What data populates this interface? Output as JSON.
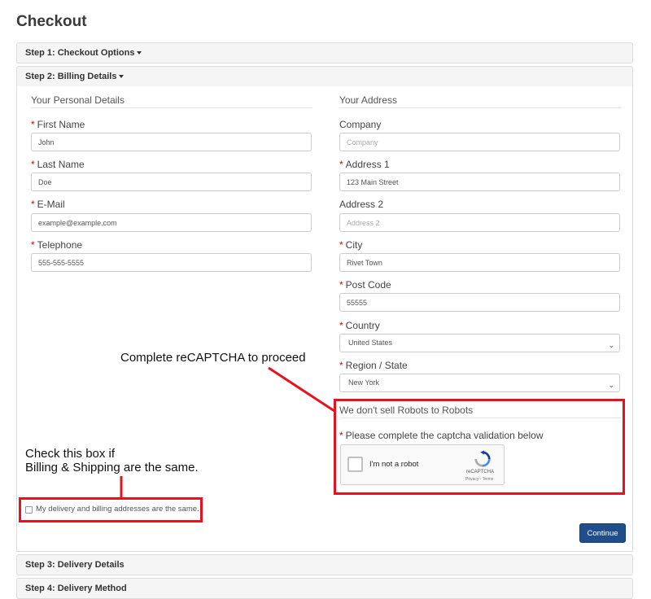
{
  "page": {
    "title": "Checkout"
  },
  "steps": {
    "step1": "Step 1: Checkout Options",
    "step2": "Step 2: Billing Details",
    "step3": "Step 3: Delivery Details",
    "step4": "Step 4: Delivery Method"
  },
  "personal": {
    "legend": "Your Personal Details",
    "first_name": {
      "label": "First Name",
      "value": "John"
    },
    "last_name": {
      "label": "Last Name",
      "value": "Doe"
    },
    "email": {
      "label": "E-Mail",
      "value": "example@example.com"
    },
    "telephone": {
      "label": "Telephone",
      "value": "555-555-5555"
    }
  },
  "address": {
    "legend": "Your Address",
    "company": {
      "label": "Company",
      "placeholder": "Company"
    },
    "address1": {
      "label": "Address 1",
      "value": "123 Main Street"
    },
    "address2": {
      "label": "Address 2",
      "placeholder": "Address 2"
    },
    "city": {
      "label": "City",
      "value": "Rivet Town"
    },
    "postcode": {
      "label": "Post Code",
      "value": "55555"
    },
    "country": {
      "label": "Country",
      "value": "United States"
    },
    "region": {
      "label": "Region / State",
      "value": "New York"
    }
  },
  "captcha": {
    "legend": "We don't sell Robots to Robots",
    "label": "Please complete the captcha validation below",
    "checkbox_text": "I'm not a robot",
    "brand": "reCAPTCHA",
    "terms": "Privacy - Terms"
  },
  "same_address": {
    "label": "My delivery and billing addresses are the same."
  },
  "continue_label": "Continue",
  "annotations": {
    "captcha_note": "Complete reCAPTCHA to proceed",
    "checkbox_note_line1": "Check this box if",
    "checkbox_note_line2": "Billing & Shipping are the same."
  },
  "colors": {
    "annotation": "#e8121e",
    "required": "#e40000",
    "primary_button": "#1f4e8a"
  }
}
